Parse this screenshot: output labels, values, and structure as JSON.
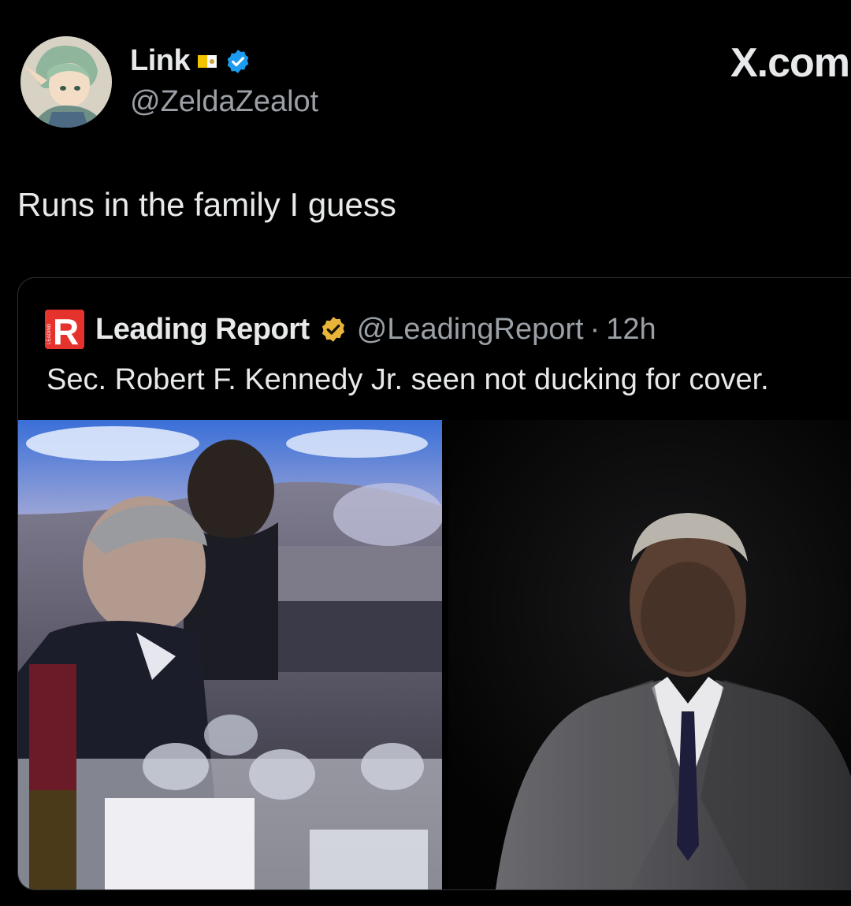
{
  "author": {
    "display_name": "Link",
    "handle": "@ZeldaZealot",
    "avatar_icon": "anime-elf-avatar",
    "flag_icon": "vatican-flag-icon",
    "verified_icon": "blue-verified-badge",
    "verified_color": "#1d9bf0"
  },
  "watermark": "X.com",
  "tweet": {
    "text": "Runs in the family I guess"
  },
  "quoted": {
    "display_name": "Leading Report",
    "handle": "@LeadingReport",
    "separator": "·",
    "time": "12h",
    "verified_icon": "gold-verified-badge",
    "verified_color": "#e8b53a",
    "logo_letter": "R",
    "logo_vertical_text": "LEADING",
    "logo_color": "#e5322d",
    "text": "Sec. Robert F. Kennedy Jr. seen not ducking for cover.",
    "media": [
      {
        "name": "banquet-photo"
      },
      {
        "name": "portrait-photo"
      }
    ]
  }
}
